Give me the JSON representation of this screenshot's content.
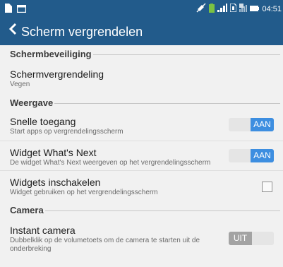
{
  "status": {
    "time": "04:51"
  },
  "header": {
    "title": "Scherm vergrendelen"
  },
  "sections": {
    "security": {
      "label": "Schermbeveiliging",
      "screen_lock": {
        "title": "Schermvergrendeling",
        "subtitle": "Vegen"
      }
    },
    "display": {
      "label": "Weergave",
      "quick_access": {
        "title": "Snelle toegang",
        "subtitle": "Start apps op vergrendelingsscherm",
        "toggle": "AAN"
      },
      "whats_next": {
        "title": "Widget What's Next",
        "subtitle": "De widget What's Next weergeven op het vergrendelingsscherm",
        "toggle": "AAN"
      },
      "widgets": {
        "title": "Widgets inschakelen",
        "subtitle": "Widget gebruiken op het vergrendelingsscherm"
      }
    },
    "camera": {
      "label": "Camera",
      "instant": {
        "title": "Instant camera",
        "subtitle": "Dubbelklik op de volumetoets om de camera te starten uit de onderbreking",
        "toggle": "UIT"
      }
    }
  },
  "colors": {
    "bar": "#225b8b",
    "accent": "#3d8ee0"
  }
}
